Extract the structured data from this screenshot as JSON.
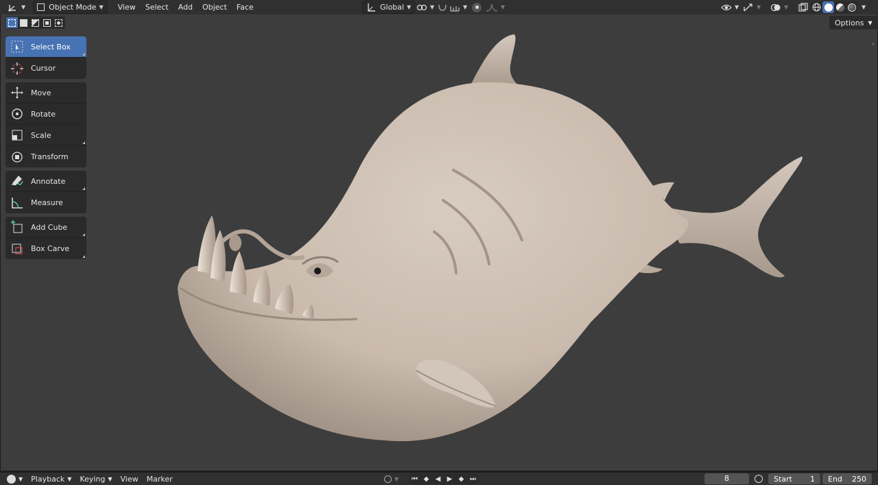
{
  "header": {
    "mode_label": "Object Mode",
    "menus": [
      "View",
      "Select",
      "Add",
      "Object",
      "Face"
    ],
    "orientation_label": "Global"
  },
  "viewport": {
    "options_label": "Options"
  },
  "toolbar": {
    "groups": [
      [
        {
          "label": "Select Box",
          "icon": "select-box-icon",
          "active": true
        },
        {
          "label": "Cursor",
          "icon": "cursor-icon"
        }
      ],
      [
        {
          "label": "Move",
          "icon": "move-icon"
        },
        {
          "label": "Rotate",
          "icon": "rotate-icon"
        },
        {
          "label": "Scale",
          "icon": "scale-icon"
        },
        {
          "label": "Transform",
          "icon": "transform-icon"
        }
      ],
      [
        {
          "label": "Annotate",
          "icon": "annotate-icon"
        },
        {
          "label": "Measure",
          "icon": "measure-icon"
        }
      ],
      [
        {
          "label": "Add Cube",
          "icon": "add-cube-icon"
        },
        {
          "label": "Box Carve",
          "icon": "box-carve-icon"
        }
      ]
    ]
  },
  "timeline": {
    "menus": [
      "Playback",
      "Keying",
      "View",
      "Marker"
    ],
    "current_frame": "8",
    "start_label": "Start",
    "start_value": "1",
    "end_label": "End",
    "end_value": "250"
  },
  "colors": {
    "accent": "#4772b3",
    "viewport_bg": "#3d3d3d",
    "header_bg": "#303030",
    "model": "#cbbdb0"
  }
}
